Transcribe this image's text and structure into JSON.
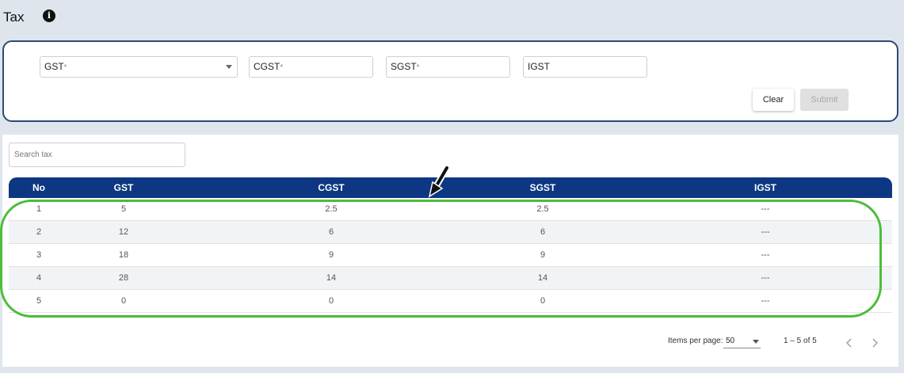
{
  "header": {
    "title": "Tax",
    "info_icon": "info-icon"
  },
  "form": {
    "gst": {
      "label": "GST",
      "required_mark": "*"
    },
    "cgst": {
      "label": "CGST",
      "required_mark": "*"
    },
    "sgst": {
      "label": "SGST",
      "required_mark": "*"
    },
    "igst": {
      "label": "IGST"
    },
    "clear_label": "Clear",
    "submit_label": "Submit"
  },
  "table": {
    "search_placeholder": "Search tax",
    "columns": [
      "No",
      "GST",
      "CGST",
      "SGST",
      "IGST"
    ],
    "rows": [
      [
        "1",
        "5",
        "2.5",
        "2.5",
        "---"
      ],
      [
        "2",
        "12",
        "6",
        "6",
        "---"
      ],
      [
        "3",
        "18",
        "9",
        "9",
        "---"
      ],
      [
        "4",
        "28",
        "14",
        "14",
        "---"
      ],
      [
        "5",
        "0",
        "0",
        "0",
        "---"
      ]
    ]
  },
  "paginator": {
    "items_per_page_label": "Items per page:",
    "items_per_page_value": "50",
    "range_label": "1 – 5 of 5"
  },
  "annotation": {
    "highlight_color": "#4bbd3a",
    "arrow_color": "#111111"
  },
  "colors": {
    "header_bg": "#0d3782",
    "form_border": "#2b4a78"
  }
}
